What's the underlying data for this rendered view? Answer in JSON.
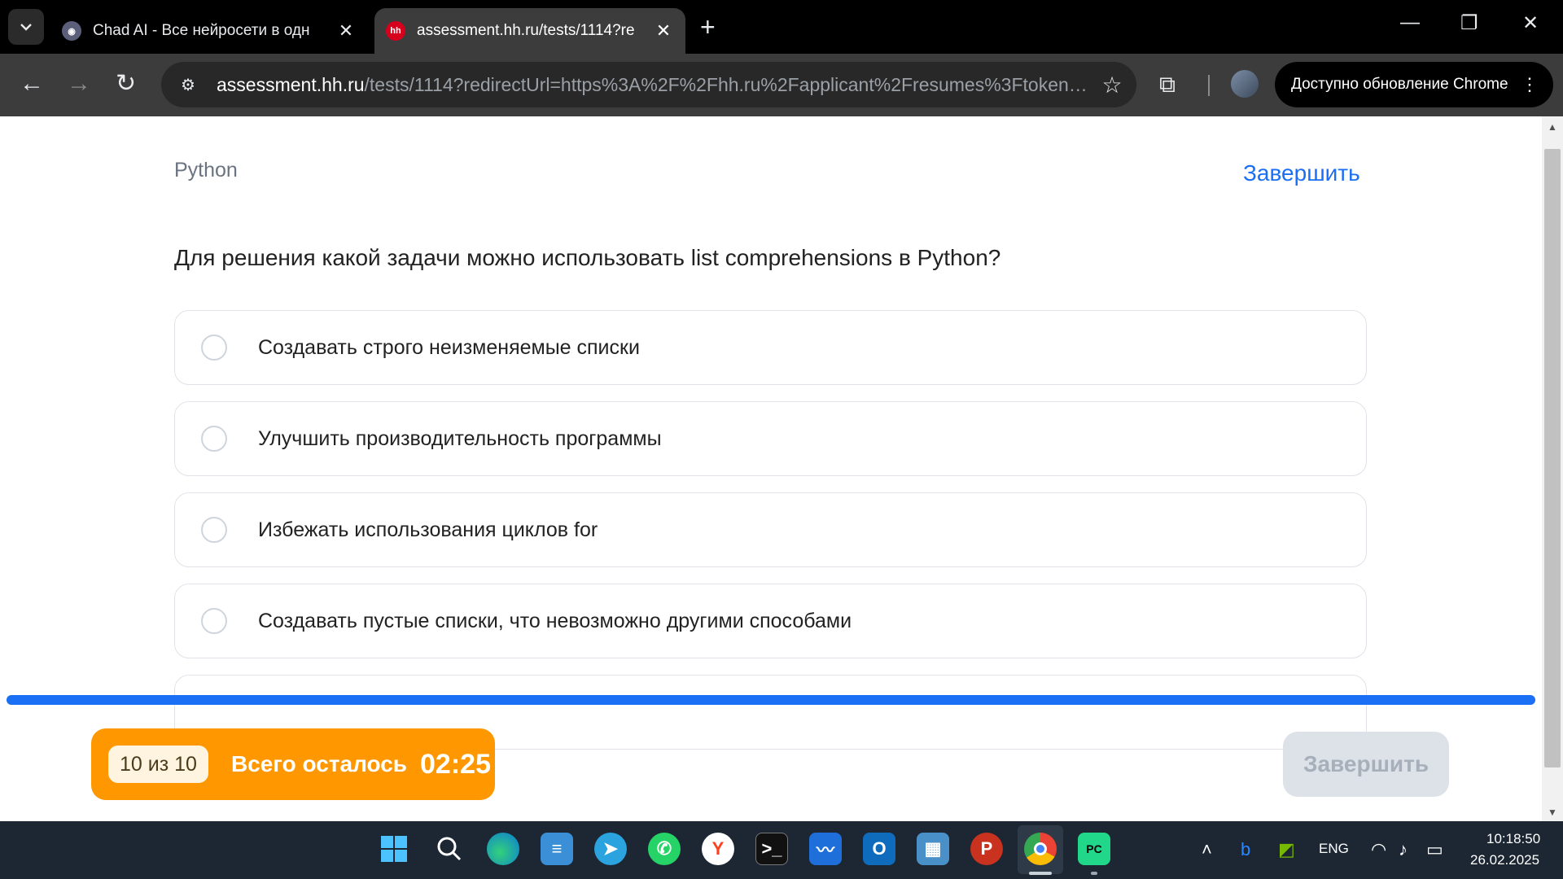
{
  "browser": {
    "tabs": [
      {
        "title": "Chad AI - Все нейросети в одн",
        "active": false
      },
      {
        "title": "assessment.hh.ru/tests/1114?re",
        "active": true,
        "favicon_text": "hh"
      }
    ],
    "url_host": "assessment.hh.ru",
    "url_rest": "/tests/1114?redirectUrl=https%3A%2F%2Fhh.ru%2Fapplicant%2Fresumes%3Ftoken%...",
    "update_label": "Доступно обновление Chrome"
  },
  "page": {
    "subject": "Python",
    "finish_link": "Завершить",
    "question": "Для решения какой задачи можно использовать list comprehensions в Python?",
    "options": [
      {
        "label": "Создавать строго неизменяемые списки"
      },
      {
        "label": "Улучшить производительность программы"
      },
      {
        "label": "Избежать использования циклов for"
      },
      {
        "label": "Создавать пустые списки, что невозможно другими способами"
      }
    ],
    "progress_fraction": 1.0,
    "counter": "10 из 10",
    "timer_label": "Всего осталось",
    "timer_value": "02:25",
    "finish_button": "Завершить"
  },
  "taskbar": {
    "apps": [
      "start",
      "search",
      "edge",
      "notepad",
      "telegram",
      "whatsapp",
      "yandex",
      "terminal",
      "resource-monitor",
      "outlook",
      "control-panel",
      "publisher",
      "chrome",
      "pycharm"
    ],
    "tray": {
      "language": "ENG",
      "time": "10:18:50",
      "date": "26.02.2025"
    }
  },
  "colors": {
    "accent_blue": "#1a6ff5",
    "timer_orange": "#ff9800",
    "hh_red": "#d6001c"
  }
}
